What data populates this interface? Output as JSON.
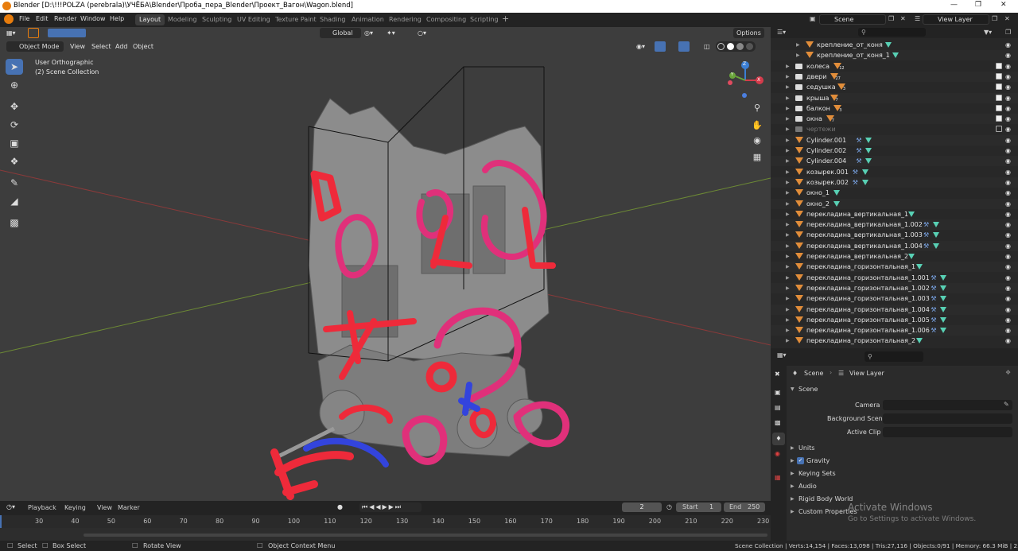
{
  "title": "Blender [D:\\!!!POLZA (perebrala)\\УЧЁБА\\Blender\\Проба_пера_Blender\\Проект_Вагон\\Wagon.blend]",
  "menu": [
    "File",
    "Edit",
    "Render",
    "Window",
    "Help"
  ],
  "workspaces": [
    "Layout",
    "Modeling",
    "Sculpting",
    "UV Editing",
    "Texture Paint",
    "Shading",
    "Animation",
    "Rendering",
    "Compositing",
    "Scripting"
  ],
  "active_workspace": "Layout",
  "scene_field": "Scene",
  "view_layer_field": "View Layer",
  "viewport": {
    "mode": "Object Mode",
    "header_menu": [
      "View",
      "Select",
      "Add",
      "Object"
    ],
    "transform_orientation": "Global",
    "options": "Options",
    "info_line1": "User Orthographic",
    "info_line2": "(2) Scene Collection",
    "axis_labels": {
      "z": "Z",
      "y": "Y",
      "x": "X"
    }
  },
  "outliner": {
    "rows": [
      {
        "name": "крепление_от_коня",
        "kind": "mesh",
        "indent": 2,
        "extras": [
          "data"
        ],
        "eye": false
      },
      {
        "name": "крепление_от_коня_1",
        "kind": "mesh",
        "indent": 2,
        "extras": [
          "data"
        ],
        "eye": false
      },
      {
        "name": "колеса",
        "kind": "collection",
        "indent": 1,
        "badge": "12",
        "checkbox": true
      },
      {
        "name": "двери",
        "kind": "collection",
        "indent": 1,
        "badge": "27",
        "checkbox": true
      },
      {
        "name": "седушка",
        "kind": "collection",
        "indent": 1,
        "badge": "3",
        "checkbox": true
      },
      {
        "name": "крыша",
        "kind": "collection",
        "indent": 1,
        "badge": "7",
        "checkbox": true
      },
      {
        "name": "балкон",
        "kind": "collection",
        "indent": 1,
        "badge": "3",
        "checkbox": true
      },
      {
        "name": "окна",
        "kind": "collection",
        "indent": 1,
        "badge": "7",
        "checkbox": true
      },
      {
        "name": "чертежи",
        "kind": "collection-disabled",
        "indent": 1,
        "checkbox": true,
        "checkbox_off": true
      },
      {
        "name": "Cylinder.001",
        "kind": "mesh",
        "indent": 1,
        "extras": [
          "mod",
          "data"
        ]
      },
      {
        "name": "Cylinder.002",
        "kind": "mesh",
        "indent": 1,
        "extras": [
          "mod",
          "data"
        ]
      },
      {
        "name": "Cylinder.004",
        "kind": "mesh",
        "indent": 1,
        "extras": [
          "mod",
          "data"
        ]
      },
      {
        "name": "козырек.001",
        "kind": "mesh",
        "indent": 1,
        "extras": [
          "mod",
          "data"
        ]
      },
      {
        "name": "козырек.002",
        "kind": "mesh",
        "indent": 1,
        "extras": [
          "mod",
          "data"
        ]
      },
      {
        "name": "окно_1",
        "kind": "mesh",
        "indent": 1,
        "extras": [
          "data"
        ]
      },
      {
        "name": "окно_2",
        "kind": "mesh",
        "indent": 1,
        "extras": [
          "data"
        ]
      },
      {
        "name": "перекладина_вертикальная_1",
        "kind": "mesh",
        "indent": 1,
        "extras": [
          "data"
        ]
      },
      {
        "name": "перекладина_вертикальная_1.002",
        "kind": "mesh",
        "indent": 1,
        "extras": [
          "mod",
          "data"
        ]
      },
      {
        "name": "перекладина_вертикальная_1.003",
        "kind": "mesh",
        "indent": 1,
        "extras": [
          "mod",
          "data"
        ]
      },
      {
        "name": "перекладина_вертикальная_1.004",
        "kind": "mesh",
        "indent": 1,
        "extras": [
          "mod",
          "data"
        ]
      },
      {
        "name": "перекладина_вертикальная_2",
        "kind": "mesh",
        "indent": 1,
        "extras": [
          "data"
        ]
      },
      {
        "name": "перекладина_горизонтальная_1",
        "kind": "mesh",
        "indent": 1,
        "extras": [
          "data"
        ]
      },
      {
        "name": "перекладина_горизонтальная_1.001",
        "kind": "mesh",
        "indent": 1,
        "extras": [
          "mod",
          "data"
        ]
      },
      {
        "name": "перекладина_горизонтальная_1.002",
        "kind": "mesh",
        "indent": 1,
        "extras": [
          "mod",
          "data"
        ]
      },
      {
        "name": "перекладина_горизонтальная_1.003",
        "kind": "mesh",
        "indent": 1,
        "extras": [
          "mod",
          "data"
        ]
      },
      {
        "name": "перекладина_горизонтальная_1.004",
        "kind": "mesh",
        "indent": 1,
        "extras": [
          "mod",
          "data"
        ]
      },
      {
        "name": "перекладина_горизонтальная_1.005",
        "kind": "mesh",
        "indent": 1,
        "extras": [
          "mod",
          "data"
        ]
      },
      {
        "name": "перекладина_горизонтальная_1.006",
        "kind": "mesh",
        "indent": 1,
        "extras": [
          "mod",
          "data"
        ]
      },
      {
        "name": "перекладина_горизонтальная_2",
        "kind": "mesh",
        "indent": 1,
        "extras": [
          "data"
        ]
      }
    ]
  },
  "properties": {
    "breadcrumb_scene": "Scene",
    "breadcrumb_view_layer": "View Layer",
    "panel_title": "Scene",
    "camera_label": "Camera",
    "background_scene_label": "Background Scene",
    "active_clip_label": "Active Clip",
    "sections": [
      "Units",
      "Gravity",
      "Keying Sets",
      "Audio",
      "Rigid Body World",
      "Custom Properties"
    ],
    "gravity_checked": true
  },
  "watermark": {
    "line1": "Activate Windows",
    "line2": "Go to Settings to activate Windows."
  },
  "timeline": {
    "menu": [
      "Playback",
      "Keying",
      "View",
      "Marker"
    ],
    "current_frame": "2",
    "start_label": "Start",
    "start": "1",
    "end_label": "End",
    "end": "250",
    "ticks": [
      "30",
      "40",
      "50",
      "60",
      "70",
      "80",
      "90",
      "100",
      "110",
      "120",
      "130",
      "140",
      "150",
      "160",
      "170",
      "180",
      "190",
      "200",
      "210",
      "220",
      "230"
    ]
  },
  "statusbar": {
    "select": "Select",
    "box_select": "Box Select",
    "rotate_view": "Rotate View",
    "context_menu": "Object Context Menu",
    "stats": "Scene Collection | Verts:14,154 | Faces:13,098 | Tris:27,116 | Objects:0/91 | Memory: 66.3 MiB | 2.92.0"
  },
  "colors": {
    "accent": "#4772b3",
    "mesh_tri": "#e18d3a",
    "data_tri": "#58d0b4",
    "scribble_red": "#ee2a3a",
    "scribble_pink": "#e0307a",
    "scribble_blue": "#3344dd"
  }
}
